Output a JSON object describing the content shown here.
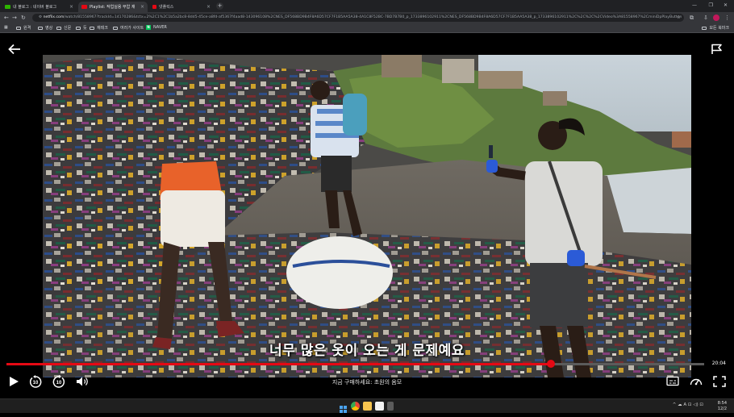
{
  "browser": {
    "tabs": [
      {
        "title": "내 블로그 : 네이버 블로그",
        "active": false
      },
      {
        "title": "Playlist: 작업실용 무압 재",
        "active": true
      },
      {
        "title": "넷플릭스",
        "active": false
      }
    ],
    "address": {
      "host": "netflix.com",
      "path": "/watch/81558967?trackId=14170286&tctx=2%2C1%2C1b5a2bc8-8dd5-45ce-a8fd-af5367f4aad8-143096108%2CNES_DF568BD9B4F8A6D57CF7F1B5AA5A38-4A1C8F52BC-7BD7B7B0_p_1733896102911%2CNES_DF568BD9B4F8A6D57CF7F1B5AA5A38_p_1733896102911%2C%2C%2C%2CVideo%3A81558967%2CminiDpPlayButton"
    },
    "bookmarks": [
      "원격",
      "영상",
      "신문",
      "듯",
      "재테크",
      "여러가 사이트",
      "NAVER"
    ],
    "bookmarks_right": "모든 북마크"
  },
  "player": {
    "subtitle": "너무 많은 옷이 오는 게 문제예요",
    "time_remaining": "20:04",
    "progress": 0.78,
    "now_playing": "지금 구매하세요: 초원의 옴모",
    "skip_back_seconds": "10",
    "skip_forward_seconds": "10"
  },
  "taskbar": {
    "tray": "^  ☁  A  ⊡  ◁)  ⊡",
    "time": "8:54",
    "date": "12/2"
  },
  "colors": {
    "accent": "#e50914",
    "chrome_dark": "#202124",
    "chrome_mid": "#35363a"
  }
}
